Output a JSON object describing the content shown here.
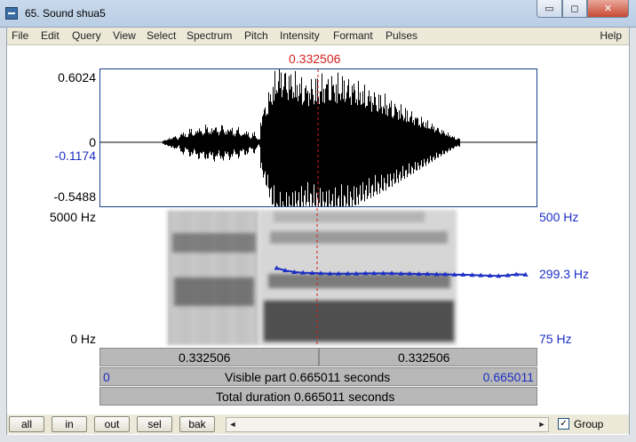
{
  "window": {
    "title": "65. Sound shua5",
    "min_glyph": "▭",
    "max_glyph": "◻",
    "close_glyph": "✕"
  },
  "menu": {
    "items": [
      "File",
      "Edit",
      "Query",
      "View",
      "Select",
      "Spectrum",
      "Pitch",
      "Intensity",
      "Formant",
      "Pulses"
    ],
    "help": "Help"
  },
  "cursor": {
    "time_label": "0.332506",
    "time_s": 0.332506,
    "color": "#d41e1e"
  },
  "waveform": {
    "max_label": "0.6024",
    "zero_label": "0",
    "cursor_value_label": "-0.1174",
    "min_label": "-0.5488",
    "max": 0.6024,
    "min": -0.5488
  },
  "spectrogram": {
    "top_freq_label": "5000 Hz",
    "bottom_freq_label": "0 Hz",
    "pitch_top_label": "500 Hz",
    "pitch_value_label": "299.3 Hz",
    "pitch_bottom_label": "75 Hz",
    "pitch_color": "#1d2fc4",
    "pitch_range_hz": [
      75,
      500
    ],
    "pitch_track": {
      "times_s": [
        0.269,
        0.282,
        0.296,
        0.309,
        0.323,
        0.336,
        0.35,
        0.363,
        0.377,
        0.39,
        0.404,
        0.417,
        0.431,
        0.444,
        0.458,
        0.471,
        0.485,
        0.498,
        0.512,
        0.525,
        0.539,
        0.552,
        0.566,
        0.579,
        0.593,
        0.606,
        0.62,
        0.633,
        0.647
      ],
      "hz": [
        316,
        309,
        304,
        302,
        301,
        300,
        299,
        299,
        299,
        299,
        300,
        300,
        300,
        300,
        299,
        299,
        298,
        298,
        297,
        297,
        296,
        296,
        295,
        294,
        293,
        292,
        294,
        297,
        296
      ]
    }
  },
  "time_axis": {
    "left_segment_label": "0.332506",
    "right_segment_label": "0.332506",
    "start_label": "0",
    "end_label": "0.665011",
    "start_s": 0,
    "end_s": 0.665011,
    "visible_label": "Visible part 0.665011 seconds",
    "total_label": "Total duration 0.665011 seconds"
  },
  "buttons": {
    "all": "all",
    "in": "in",
    "out": "out",
    "sel": "sel",
    "bak": "bak"
  },
  "group": {
    "label": "Group",
    "checked": true,
    "check_glyph": "✓"
  },
  "scrollbar": {
    "left_arrow": "◄",
    "right_arrow": "►"
  }
}
